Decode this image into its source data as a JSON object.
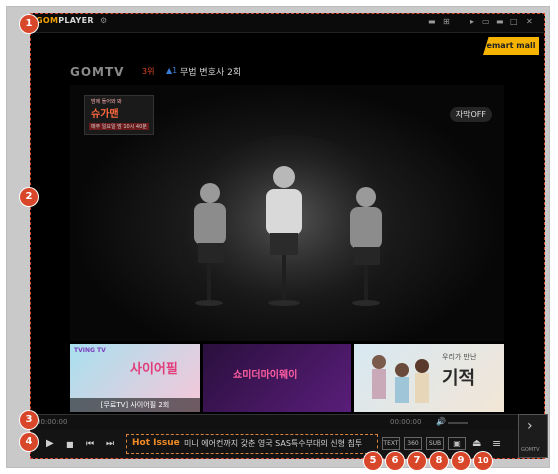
{
  "titlebar": {
    "logo_prefix": "GOM",
    "logo_suffix": "PLAYER",
    "settings_icon": "⚙",
    "window_controls": [
      "▬",
      "□",
      "✕"
    ]
  },
  "sponsor": {
    "label": "emart mall"
  },
  "channel": {
    "logo": "GOMTV",
    "rank": "3위",
    "rank_change": "▲1",
    "program": "무법 변호사 2회"
  },
  "video": {
    "show_badge": {
      "line1": "밤에 들어와 봐",
      "title": "슈가맨",
      "schedule": "매주 일요일 밤 10시 40분"
    },
    "subtitle_toggle": "자막OFF"
  },
  "thumbnails": [
    {
      "caption": "[무료TV] 사이어필 2회",
      "colors": [
        "#a8e0ef",
        "#f7c7d9"
      ],
      "tag": "TVING TV",
      "big": "사이어필"
    },
    {
      "caption": "",
      "colors": [
        "#2a0f3d",
        "#5a1e7a"
      ],
      "big": "쇼미더마이웨이"
    },
    {
      "caption": "",
      "colors": [
        "#d7e8f2",
        "#f3e6d6"
      ],
      "big": "기적",
      "small": "우리가 만난"
    }
  ],
  "seekbar": {
    "time_elapsed": "00:00:00",
    "time_total": "00:00:00",
    "volume_icon": "🔊"
  },
  "controls": {
    "play_icon": "▶",
    "stop_icon": "■",
    "prev_icon": "⏮",
    "next_icon": "⏭",
    "hot_label": "Hot Issue",
    "ticker_text": "미니 에어컨까지 갖춘 영국 SAS특수부대의 신형 침투",
    "right_buttons": [
      "TEXT",
      "360",
      "SUB",
      "▣",
      "⏏",
      "≡"
    ]
  },
  "sidepanel": {
    "arrow": "›",
    "label": "GOMTV"
  },
  "callouts": [
    "1",
    "2",
    "3",
    "4",
    "5",
    "6",
    "7",
    "8",
    "9",
    "10"
  ]
}
